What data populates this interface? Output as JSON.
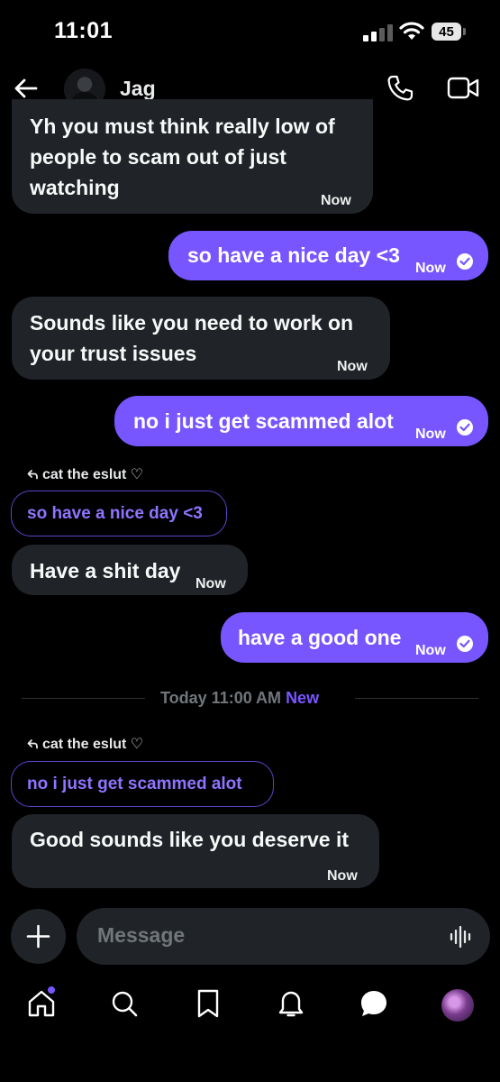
{
  "status_bar": {
    "time": "11:01",
    "battery": "45"
  },
  "header": {
    "contact_name": "Jag"
  },
  "messages": [
    {
      "text": "Yh you must think really low of\npeople to scam out of just\nwatching",
      "time": "Now"
    },
    {
      "text": "so have a nice day <3",
      "time": "Now"
    },
    {
      "text": "Sounds like you need to work on\nyour trust issues",
      "time": "Now"
    },
    {
      "text": "no i just get scammed alot",
      "time": "Now"
    },
    {
      "reply_to": "cat the eslut ♡",
      "quote": "so have a nice day <3",
      "text": "Have a shit day",
      "time": "Now"
    },
    {
      "text": "have a good one",
      "time": "Now"
    },
    {
      "reply_to": "cat the eslut ♡",
      "quote": "no i just get scammed alot",
      "text": "Good sounds like you deserve it",
      "time": "Now"
    }
  ],
  "divider": {
    "text": "Today 11:00 AM",
    "new_label": "New"
  },
  "composer": {
    "placeholder": "Message"
  },
  "colors": {
    "accent": "#7856ff",
    "incoming_bubble": "#202327",
    "background": "#000000"
  },
  "icons": [
    "back-arrow-icon",
    "phone-icon",
    "video-icon",
    "plus-icon",
    "voice-icon",
    "home-icon",
    "search-icon",
    "bookmark-icon",
    "bell-icon",
    "messages-icon"
  ]
}
